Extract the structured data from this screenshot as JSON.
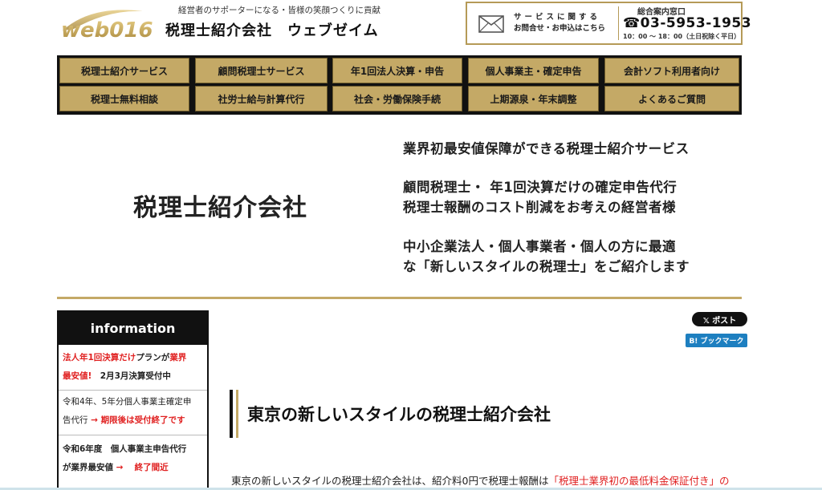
{
  "header": {
    "logo_text": "web016",
    "tagline": "経営者のサポーターになる・皆様の笑顔つくりに貢献",
    "company_name": "税理士紹介会社　ウェブゼイム"
  },
  "contact": {
    "line1": "サービスに関する",
    "line2": "お問合せ・お申込はこちら",
    "phone_label": "総合案内窓口",
    "phone": "☎03-5953-1953",
    "hours": "10：00 ～ 18：00（土日祝除く平日）"
  },
  "nav": {
    "row1": [
      "税理士紹介サービス",
      "顧問税理士サービス",
      "年1回法人決算・申告",
      "個人事業主・確定申告",
      "会計ソフト利用者向け"
    ],
    "row2": [
      "税理士無料相談",
      "社労士給与計算代行",
      "社会・労働保険手続",
      "上期源泉・年末調整",
      "よくあるご質問"
    ]
  },
  "hero": {
    "title": "税理士紹介会社",
    "line1": "業界初最安値保障ができる税理士紹介サービス",
    "line2": "顧問税理士・ 年1回決算だけの確定申告代行",
    "line3": "税理士報酬のコスト削減をお考えの経営者様",
    "line4": "中小企業法人・個人事業者・個人の方に最適",
    "line5": "な「新しいスタイルの税理士」をご紹介します"
  },
  "info": {
    "heading": "information",
    "item1_a": "法人年1回決算だけ",
    "item1_b": "プランが",
    "item1_c": "業界",
    "item1_d": "最安値!",
    "item1_e": "　2月3月決算受付中",
    "item2_a": "令和4年、5年分個人事業主確定申",
    "item2_b": "告代行",
    "item2_c": " → 期限後は受付終了です",
    "item3_a": "令和6年度　個人事業主申告代行",
    "item3_b": "が業界最安値",
    "item3_c": " → 　終了間近"
  },
  "share": {
    "x_post": "𝕏 ポスト",
    "hatena": "B! ブックマーク"
  },
  "section": {
    "title": "東京の新しいスタイルの税理士紹介会社",
    "body_a": "東京の新しいスタイルの税理士紹介会社は、紹介料0円で税理士報酬は",
    "body_b": "「税理士業界初の最低料金保証付き」の"
  },
  "colors": {
    "gold": "#c4a966",
    "nav_bg": "#111111",
    "accent_red": "#e02020",
    "hatena_blue": "#1d7fc0"
  }
}
